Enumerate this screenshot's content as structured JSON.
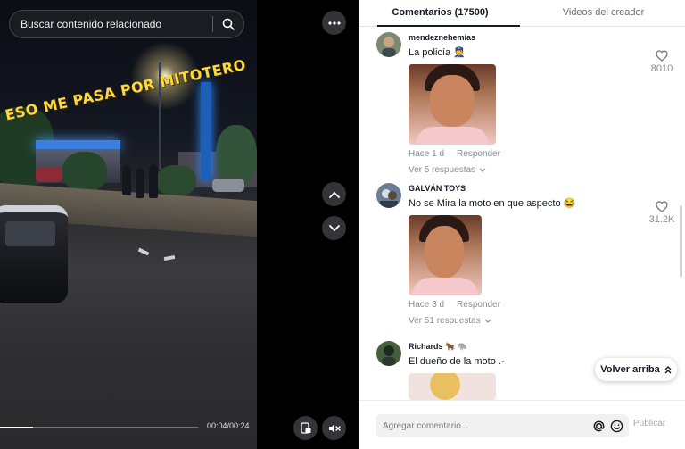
{
  "search": {
    "placeholder": "Buscar contenido relacionado"
  },
  "video": {
    "overlay_text": "ESO ME PASA POR MITOTERO",
    "time": "00:04/00:24",
    "progress": 0.167
  },
  "tabs": [
    {
      "label": "Comentarios (17500)",
      "active": true
    },
    {
      "label": "Videos del creador",
      "active": false
    }
  ],
  "comments": [
    {
      "user": "mendeznehemias",
      "text": "La policía 👮",
      "time": "Hace 1 d",
      "reply_label": "Responder",
      "replies_label": "Ver 5 respuestas",
      "likes": "8010"
    },
    {
      "user": "GALVÁN TOYS",
      "text": "No se Mira la moto en que aspecto 😂",
      "time": "Hace 3 d",
      "reply_label": "Responder",
      "replies_label": "Ver 51 respuestas",
      "likes": "31.2K"
    },
    {
      "user": "Richards 🐂 🐃",
      "text": "El dueño de la moto .-",
      "time": "",
      "reply_label": "",
      "replies_label": "",
      "likes": ""
    }
  ],
  "back_to_top": "Volver arriba",
  "comment_box": {
    "placeholder": "Agregar comentario...",
    "publish_label": "Publicar"
  },
  "icons": {
    "search": "search-icon",
    "more": "more-horizontal-icon",
    "up": "chevron-up-icon",
    "down": "chevron-down-icon",
    "pip": "picture-in-picture-icon",
    "mute": "speaker-muted-icon",
    "heart": "heart-icon",
    "mention": "at-icon",
    "emoji": "emoji-icon",
    "caret": "double-chevron-up-icon"
  },
  "colors": {
    "overlay_yellow": "#ffd93a",
    "panel_bg": "#ffffff",
    "text": "#161823",
    "muted": "#8a8b91"
  }
}
